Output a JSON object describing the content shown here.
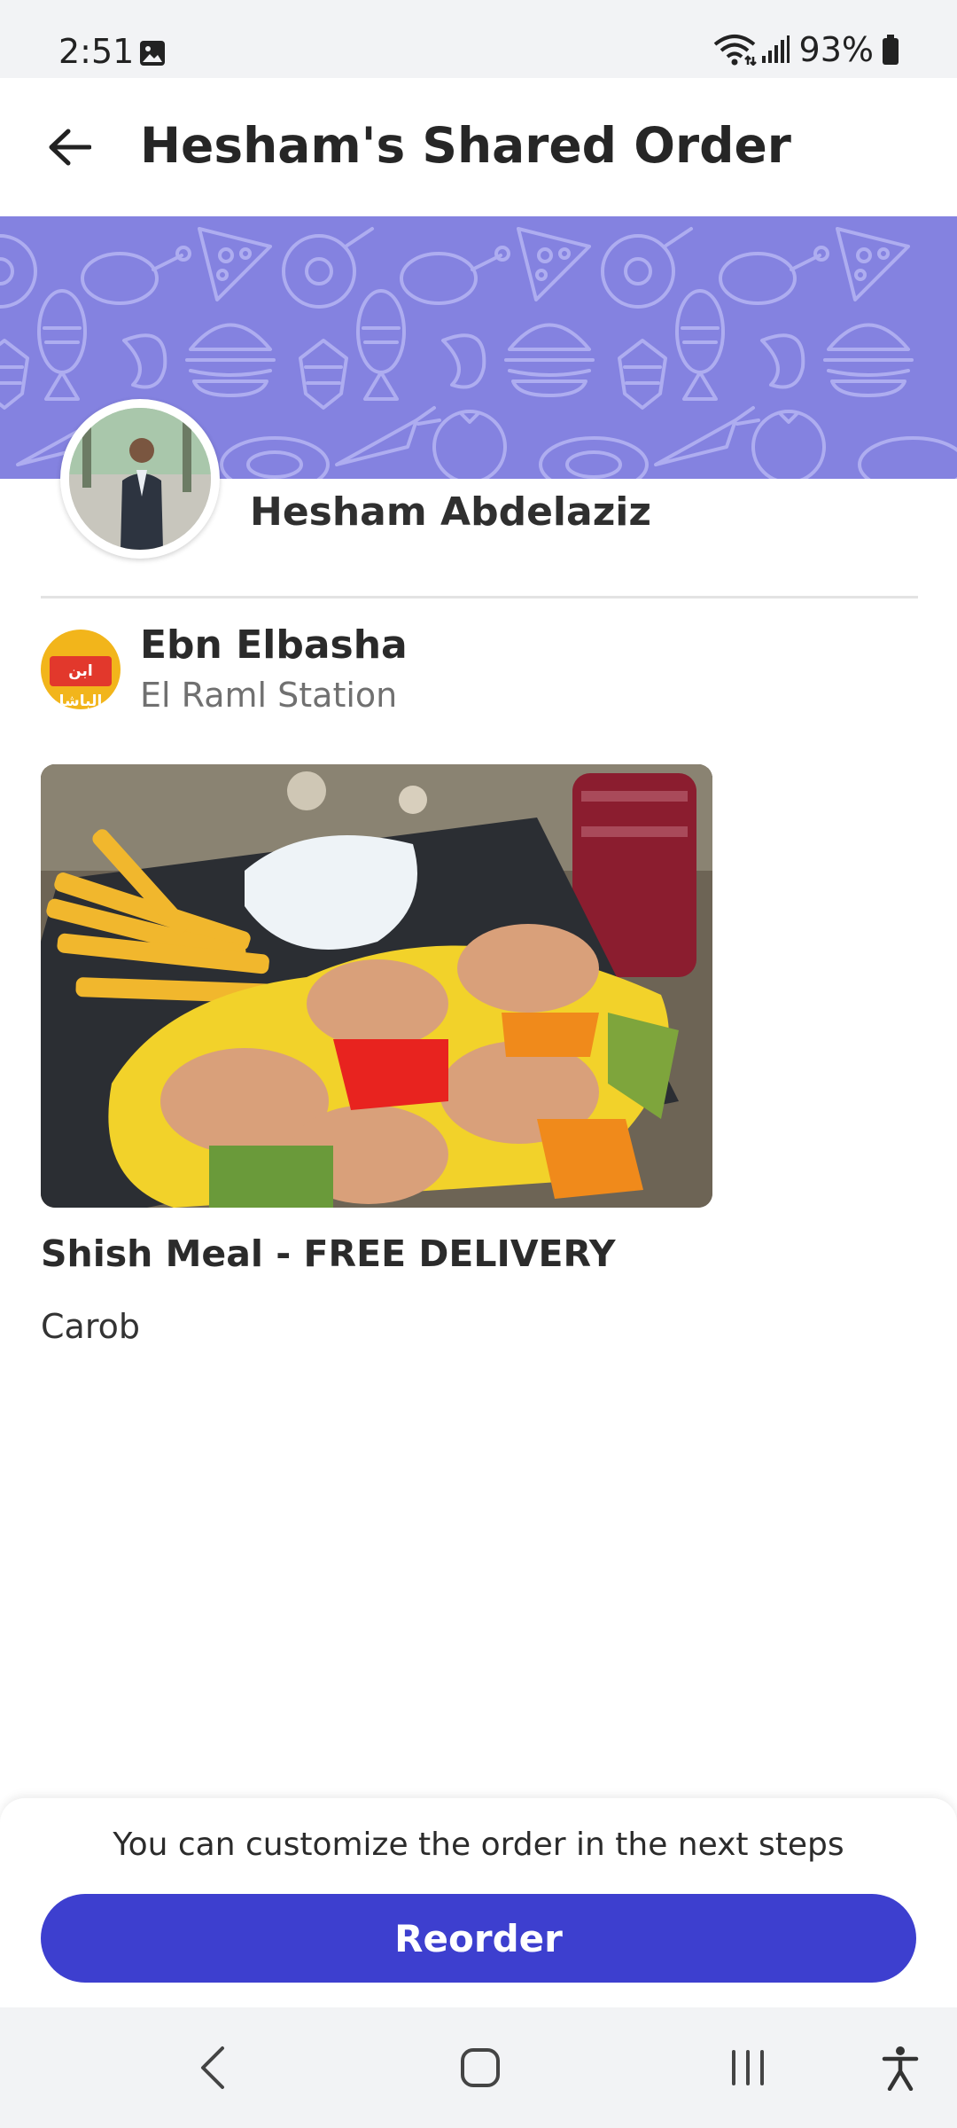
{
  "status_bar": {
    "time": "2:51",
    "battery_percent": "93%",
    "icons": [
      "gallery-icon",
      "wifi-icon",
      "signal-icon",
      "battery-icon"
    ]
  },
  "header": {
    "title": "Hesham's Shared Order",
    "back_icon": "arrow-left-icon"
  },
  "profile": {
    "name": "Hesham Abdelaziz",
    "banner_color": "#8482e0"
  },
  "restaurant": {
    "name": "Ebn Elbasha",
    "branch": "El Raml Station",
    "logo_text": "ابن الباشا",
    "logo_color": "#f2b51b"
  },
  "item": {
    "title": "Shish Meal - FREE DELIVERY",
    "option": "Carob"
  },
  "footer": {
    "note": "You can customize the order in the next steps",
    "reorder_label": "Reorder",
    "accent_color": "#3d3fcf"
  },
  "nav_bar": {
    "buttons": [
      "back-nav-icon",
      "home-nav-icon",
      "recents-nav-icon",
      "accessibility-icon"
    ]
  }
}
